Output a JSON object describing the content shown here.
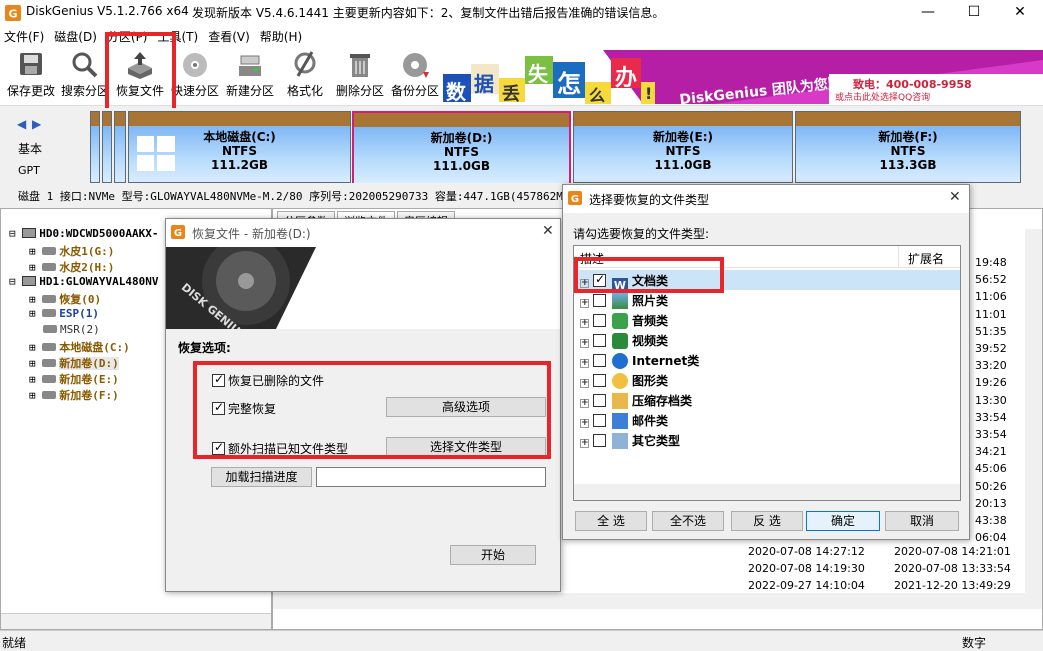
{
  "window": {
    "title": "DiskGenius V5.1.2.766 x64",
    "notice": "发现新版本 V5.4.6.1441 主要更新内容如下：2、复制文件出错后报告准确的错误信息。",
    "controls": {
      "minimize": "—",
      "maximize": "☐",
      "close": "✕"
    }
  },
  "menu": [
    "文件(F)",
    "磁盘(D)",
    "分区(P)",
    "工具(T)",
    "查看(V)",
    "帮助(H)"
  ],
  "toolbar": {
    "items": [
      {
        "label": "保存更改",
        "icon": "save-icon"
      },
      {
        "label": "搜索分区",
        "icon": "search-icon"
      },
      {
        "label": "恢复文件",
        "icon": "recover-icon"
      },
      {
        "label": "快速分区",
        "icon": "disk-icon"
      },
      {
        "label": "新建分区",
        "icon": "new-partition-icon"
      },
      {
        "label": "格式化",
        "icon": "format-icon"
      },
      {
        "label": "删除分区",
        "icon": "trash-icon"
      },
      {
        "label": "备份分区",
        "icon": "backup-icon"
      }
    ]
  },
  "banner": {
    "tiles": [
      "数",
      "据",
      "丢",
      "失",
      "怎",
      "么",
      "办",
      "!"
    ],
    "brand": "DiskGenius 团队为您服务",
    "phone": "致电：400-008-9958",
    "qq": "或点击此处选择QQ咨询"
  },
  "diskbar": {
    "label1": "基本",
    "label2": "GPT",
    "partitions": [
      {
        "name": "本地磁盘(C:)",
        "fs": "NTFS",
        "size": "111.2GB"
      },
      {
        "name": "新加卷(D:)",
        "fs": "NTFS",
        "size": "111.0GB"
      },
      {
        "name": "新加卷(E:)",
        "fs": "NTFS",
        "size": "111.0GB"
      },
      {
        "name": "新加卷(F:)",
        "fs": "NTFS",
        "size": "113.3GB"
      }
    ]
  },
  "infobar": "磁盘 1 接口:NVMe  型号:GLOWAYVAL480NVMe-M.2/80  序列号:202005290733  容量:447.1GB(457862MB)",
  "tree": {
    "nodes": [
      {
        "text": "HD0:WDCWD5000AAKX-",
        "color": "#000"
      },
      {
        "text": "水皮1(G:)",
        "color": "#8a5a00"
      },
      {
        "text": "水皮2(H:)",
        "color": "#8a5a00"
      },
      {
        "text": "HD1:GLOWAYVAL480NV",
        "color": "#000"
      },
      {
        "text": "恢复(0)",
        "color": "#8a5a00"
      },
      {
        "text": "ESP(1)",
        "color": "#1a3fa0"
      },
      {
        "text": "MSR(2)",
        "color": "#333"
      },
      {
        "text": "本地磁盘(C:)",
        "color": "#8a5a00"
      },
      {
        "text": "新加卷(D:)",
        "color": "#8a5a00"
      },
      {
        "text": "新加卷(E:)",
        "color": "#8a5a00"
      },
      {
        "text": "新加卷(F:)",
        "color": "#8a5a00"
      }
    ]
  },
  "right_tabs": [
    "分区参数",
    "浏览文件",
    "扇区编辑"
  ],
  "right_list": {
    "times": [
      "19:48",
      "56:52",
      "11:06",
      "11:01",
      "51:35",
      "39:52",
      "33:20",
      "19:26",
      "13:30",
      "33:54",
      "33:54",
      "34:21",
      "45:06",
      "50:26",
      "20:13",
      "43:38",
      "06:04"
    ],
    "rows": [
      {
        "c1": "2020-07-08 14:27:12",
        "c2": "2020-07-08 14:21:01"
      },
      {
        "c1": "2020-07-08 14:19:30",
        "c2": "2020-07-08 13:33:54"
      },
      {
        "c1": "2022-09-27 14:10:04",
        "c2": "2021-12-20 13:49:29"
      }
    ]
  },
  "status": {
    "left": "就绪",
    "right": "数字"
  },
  "recover_dialog": {
    "title": "恢复文件 - 新加卷(D:)",
    "section": "恢复选项:",
    "options": [
      {
        "label": "恢复已删除的文件",
        "checked": true
      },
      {
        "label": "完整恢复",
        "checked": true
      },
      {
        "label": "额外扫描已知文件类型",
        "checked": true
      }
    ],
    "advanced_button": "高级选项",
    "choose_types_button": "选择文件类型",
    "load_progress_button": "加载扫描进度",
    "progress_path": "",
    "start_button": "开始"
  },
  "types_dialog": {
    "title": "选择要恢复的文件类型",
    "prompt": "请勾选要恢复的文件类型:",
    "columns": [
      "描述",
      "扩展名"
    ],
    "items": [
      {
        "label": "文档类",
        "checked": true,
        "icon": "word-icon"
      },
      {
        "label": "照片类",
        "checked": false,
        "icon": "photo-icon"
      },
      {
        "label": "音频类",
        "checked": false,
        "icon": "audio-icon"
      },
      {
        "label": "视频类",
        "checked": false,
        "icon": "video-icon"
      },
      {
        "label": "Internet类",
        "checked": false,
        "icon": "internet-icon"
      },
      {
        "label": "图形类",
        "checked": false,
        "icon": "graphics-icon"
      },
      {
        "label": "压缩存档类",
        "checked": false,
        "icon": "archive-icon"
      },
      {
        "label": "邮件类",
        "checked": false,
        "icon": "mail-icon"
      },
      {
        "label": "其它类型",
        "checked": false,
        "icon": "other-icon"
      }
    ],
    "buttons": {
      "select_all": "全  选",
      "select_none": "全不选",
      "invert": "反  选",
      "ok": "确定",
      "cancel": "取消"
    }
  }
}
